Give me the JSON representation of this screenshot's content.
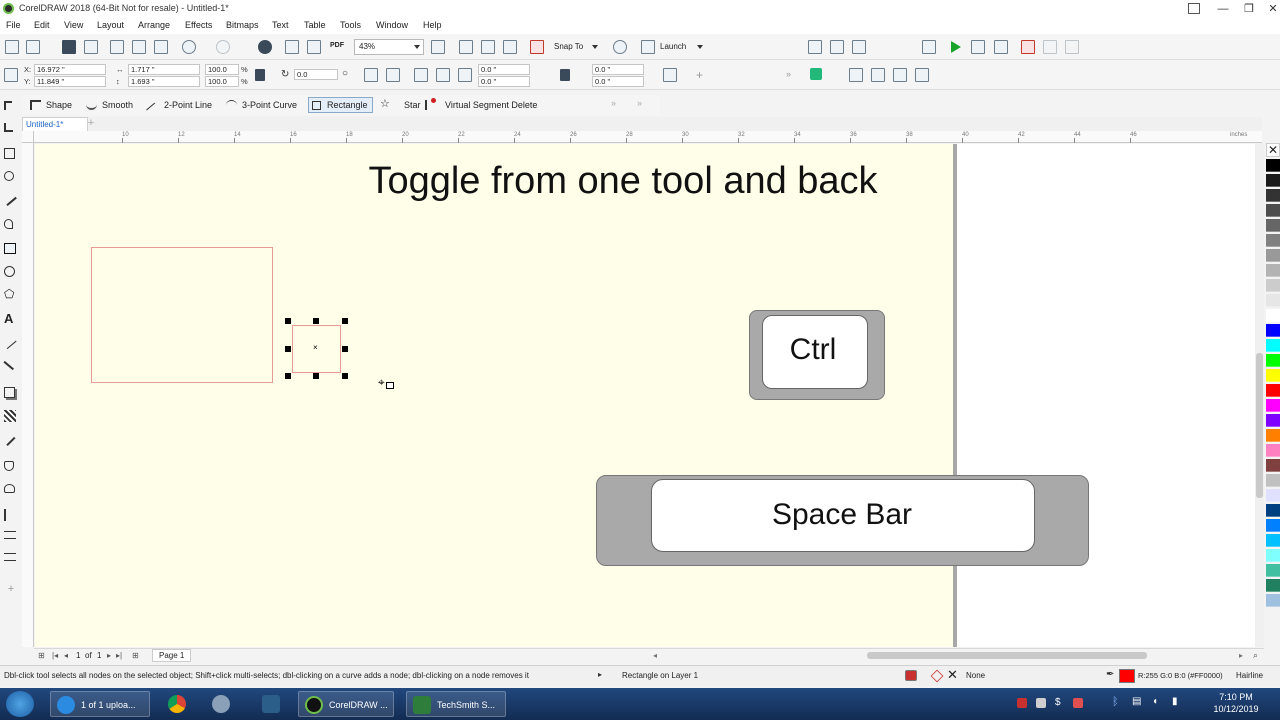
{
  "window": {
    "title": "CorelDRAW 2018 (64-Bit Not for resale) - Untitled-1*",
    "minimize": "—",
    "maximize": "❐",
    "close": "✕"
  },
  "menu": [
    "File",
    "Edit",
    "View",
    "Layout",
    "Arrange",
    "Effects",
    "Bitmaps",
    "Text",
    "Table",
    "Tools",
    "Window",
    "Help"
  ],
  "standard_toolbar": {
    "zoom": "43%",
    "snap_to": "Snap To",
    "launch": "Launch",
    "pdf_label": "PDF"
  },
  "property_bar": {
    "x": "16.972 \"",
    "y": "11.849 \"",
    "width": "1.717 \"",
    "height": "1.693 \"",
    "scale_x": "100.0",
    "scale_y": "100.0",
    "percent": "%",
    "rotation": "0.0",
    "corner_tl": "0.0 \"",
    "corner_bl": "0.0 \"",
    "corner_tr": "0.0 \"",
    "corner_br": "0.0 \""
  },
  "tool_options": {
    "shape": "Shape",
    "smooth": "Smooth",
    "two_point_line": "2-Point Line",
    "three_point_curve": "3-Point Curve",
    "rectangle": "Rectangle",
    "star": "Star",
    "virtual_segment_delete": "Virtual Segment Delete"
  },
  "document_tab": "Untitled-1*",
  "add_tab": "+",
  "ruler_labels": [
    "10",
    "12",
    "14",
    "16",
    "18",
    "20",
    "22",
    "24",
    "26",
    "28",
    "30",
    "32",
    "34",
    "36",
    "38",
    "40",
    "42",
    "44",
    "46"
  ],
  "ruler_unit": "inches",
  "canvas": {
    "title": "Toggle from one tool and back",
    "key_ctrl": "Ctrl",
    "key_space": "Space Bar"
  },
  "page_nav": {
    "current": "1",
    "of": "of",
    "total": "1",
    "page_tab": "Page 1"
  },
  "status": {
    "hint": "Dbl-click tool selects all nodes on the selected object; Shift+click multi-selects; dbl-clicking on a curve adds a node; dbl-clicking on a node removes it",
    "object": "Rectangle on Layer 1",
    "fill": "None",
    "outline_color": "R:255 G:0 B:0 (#FF0000)",
    "outline_width": "Hairline",
    "outline_hex": "#ff0000"
  },
  "taskbar": {
    "ie_task": "1 of 1 uploa...",
    "corel_task": "CorelDRAW ...",
    "techsmith_task": "TechSmith S...",
    "time": "7:10 PM",
    "date": "10/12/2019"
  },
  "palette": [
    "#000000",
    "#1a1a1a",
    "#333333",
    "#4d4d4d",
    "#666666",
    "#808080",
    "#999999",
    "#b3b3b3",
    "#cccccc",
    "#e6e6e6",
    "#ffffff",
    "#0000ff",
    "#00ffff",
    "#00ff00",
    "#ffff00",
    "#ff0000",
    "#ff00ff",
    "#8000ff",
    "#ff8000",
    "#ff80c0",
    "#804040",
    "#c0c0c0",
    "#e0e0ff",
    "#004080",
    "#0080ff",
    "#00c0ff",
    "#80ffff",
    "#40c0a0",
    "#208060",
    "#a0c0e0"
  ]
}
